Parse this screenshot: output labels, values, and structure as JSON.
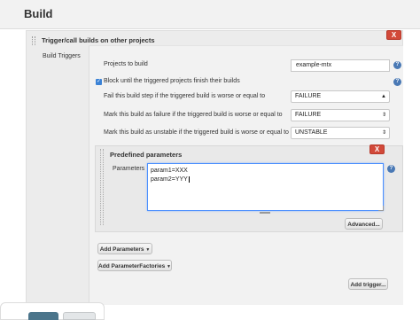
{
  "page": {
    "title": "Build"
  },
  "section": {
    "title": "Trigger/call builds on other projects",
    "side_label": "Build Triggers",
    "close_label": "X"
  },
  "trigger": {
    "projects_label": "Projects to build",
    "projects_value": "example-mtx",
    "block_label": "Block until the triggered projects finish their builds",
    "block_checked": true,
    "fail_label": "Fail this build step if the triggered build is worse or equal to",
    "fail_value": "FAILURE",
    "failure_label": "Mark this build as failure if the triggered build is worse or equal to",
    "failure_value": "FAILURE",
    "unstable_label": "Mark this build as unstable if the triggered build is worse or equal to",
    "unstable_value": "UNSTABLE"
  },
  "params": {
    "title": "Predefined parameters",
    "close_label": "X",
    "field_label": "Parameters",
    "line1": "param1=XXX",
    "line2": "param2=YYY",
    "advanced_label": "Advanced..."
  },
  "buttons": {
    "add_parameters": "Add Parameters",
    "add_parameter_factories": "Add ParameterFactories",
    "add_trigger": "Add trigger..."
  },
  "icons": {
    "help": "help-icon",
    "dropdown": "chevron-down-icon",
    "updown": "select-updown-icon",
    "drag": "drag-handle-icon"
  },
  "colors": {
    "delete_red": "#d24939",
    "help_blue": "#4a79b5",
    "focus_blue": "#4d90fe"
  }
}
